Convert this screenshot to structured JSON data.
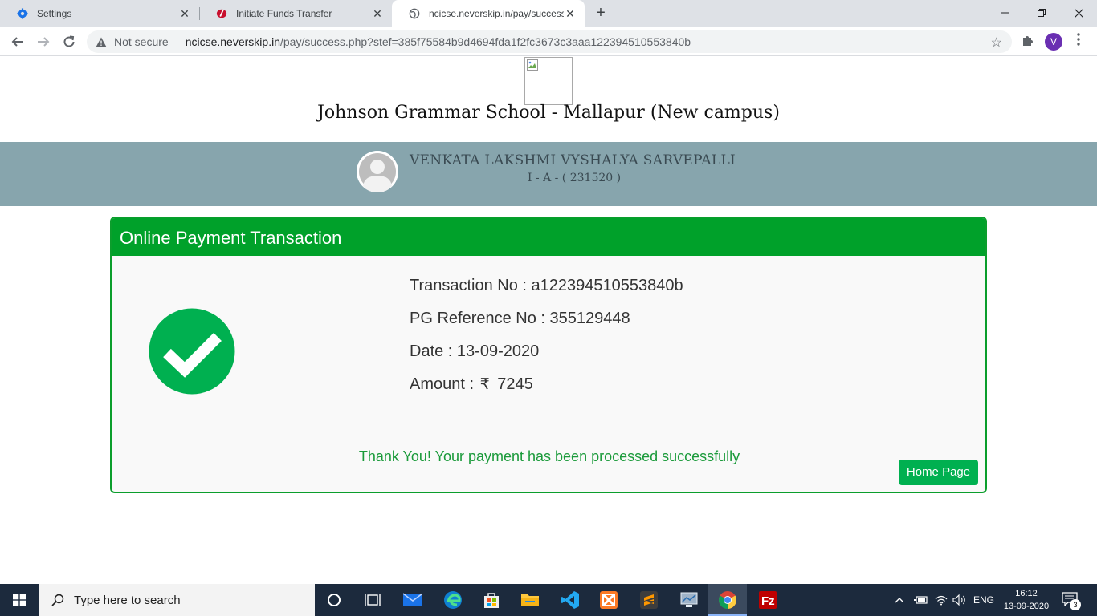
{
  "browser": {
    "tabs": [
      {
        "title": "Settings",
        "icon": "gear-icon",
        "close": "✕"
      },
      {
        "title": "Initiate Funds Transfer",
        "icon": "bank-logo-icon",
        "close": "✕"
      },
      {
        "title": "ncicse.neverskip.in/pay/success.p",
        "icon": "globe-icon",
        "close": "✕"
      }
    ],
    "new_tab": "+",
    "window_controls": {
      "minimize": "—",
      "maximize": "❐",
      "close": "✕"
    },
    "security_label": "Not secure",
    "url_host": "ncicse.neverskip.in",
    "url_path": "/pay/success.php?stef=385f75584b9d4694fda1f2fc3673c3aaa122394510553840b",
    "profile_initial": "V"
  },
  "page": {
    "school_name": "Johnson Grammar School - Mallapur (New campus)",
    "student": {
      "name": "VENKATA LAKSHMI VYSHALYA SARVEPALLI",
      "class_line": "I - A - ( 231520 )"
    },
    "panel_title": "Online Payment Transaction",
    "transaction": {
      "transaction_no_label": "Transaction No : ",
      "transaction_no": "a122394510553840b",
      "pg_ref_label": "PG Reference No : ",
      "pg_ref": "355129448",
      "date_label": "Date : ",
      "date": "13-09-2020",
      "amount_label": "Amount : ",
      "currency_symbol": "₹",
      "amount": "7245"
    },
    "thank_you": "Thank You! Your payment has been processed successfully",
    "home_button": "Home Page"
  },
  "taskbar": {
    "search_placeholder": "Type here to search",
    "language": "ENG",
    "time": "16:12",
    "date": "13-09-2020",
    "notification_count": "3"
  },
  "colors": {
    "panel_green": "#00a12a",
    "success_green": "#00b050",
    "band": "#87a5ad"
  }
}
